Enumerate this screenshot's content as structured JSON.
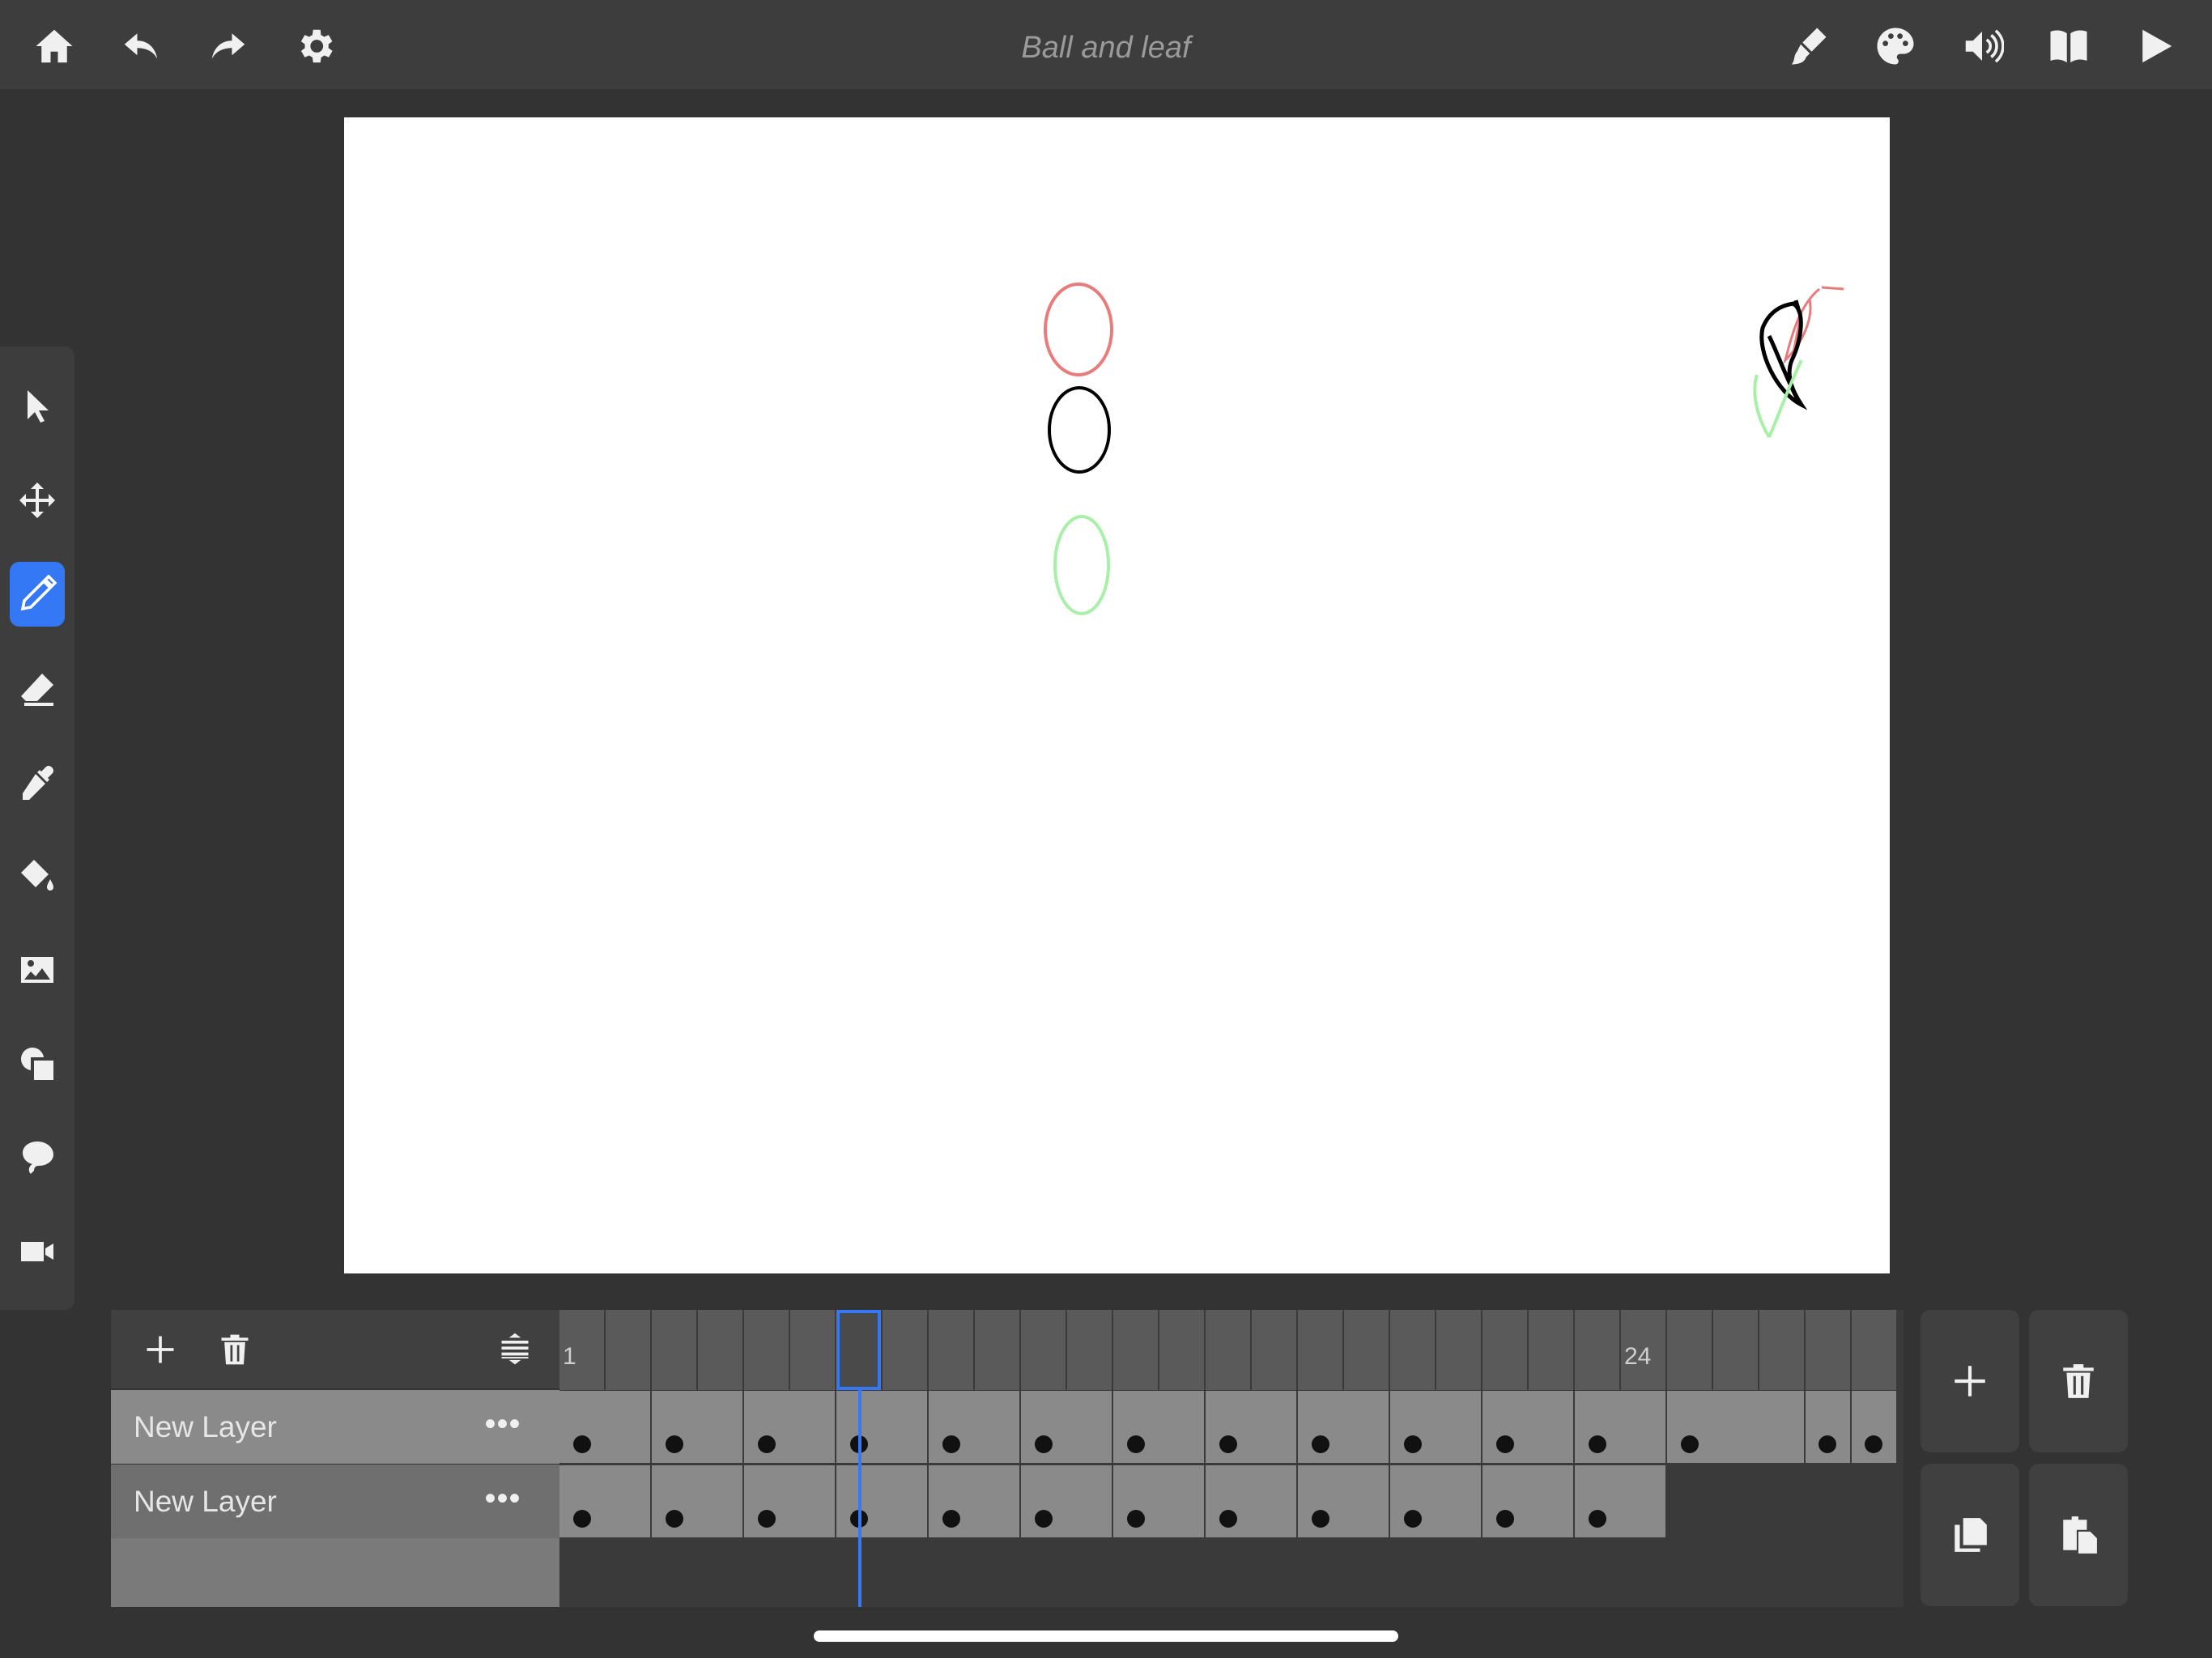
{
  "document": {
    "title": "Ball and leaf"
  },
  "toolbar": {
    "left_icons": [
      "home-icon",
      "undo-icon",
      "redo-icon",
      "settings-icon"
    ],
    "right_icons": [
      "brush-settings-icon",
      "palette-icon",
      "sound-icon",
      "book-icon",
      "play-icon"
    ]
  },
  "tools": {
    "items": [
      "select-tool-icon",
      "move-tool-icon",
      "pencil-tool-icon",
      "eraser-tool-icon",
      "eyedropper-tool-icon",
      "fill-tool-icon",
      "image-tool-icon",
      "shapes-tool-icon",
      "lasso-tool-icon",
      "camera-tool-icon"
    ],
    "active": "pencil-tool-icon",
    "accent_color": "#3478f6"
  },
  "layers": {
    "items": [
      {
        "name": "New Layer",
        "more": "•••",
        "selected": true
      },
      {
        "name": "New Layer",
        "more": "•••",
        "selected": false
      }
    ]
  },
  "timeline": {
    "frame_labels": {
      "first": "1",
      "marker": "24"
    },
    "current_frame": 7,
    "playhead_color": "#3478f6"
  },
  "canvas": {
    "background": "#ffffff",
    "stroke_colors": {
      "previous": "#e87c7c",
      "current": "#000000",
      "next": "#a8f0a8"
    }
  }
}
